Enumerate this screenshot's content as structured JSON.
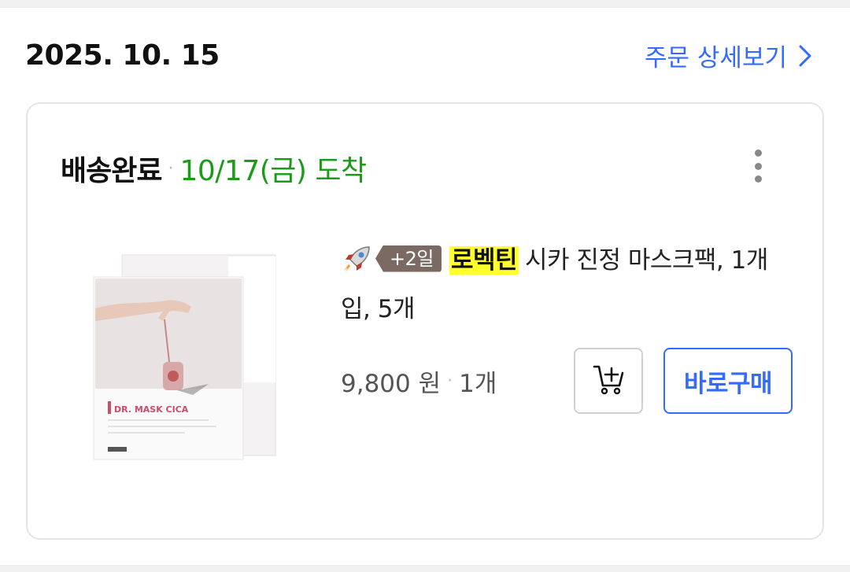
{
  "order": {
    "date": "2025. 10. 15",
    "detail_link_label": "주문 상세보기",
    "detail_link_icon": "chevron-right-icon"
  },
  "shipment": {
    "status": "배송완료",
    "separator": "·",
    "arrival": "10/17(금) 도착",
    "more_icon": "more-vertical-icon"
  },
  "product": {
    "image_label": "DR. MASK CICA",
    "rocket_icon": "rocket-icon",
    "delivery_badge": "+2일",
    "brand": "로벡틴",
    "name": "시카 진정 마스크팩, 1개입, 5개",
    "price": "9,800 원",
    "price_separator": "·",
    "quantity": "1개"
  },
  "actions": {
    "cart_icon": "add-to-cart-icon",
    "buy_now_label": "바로구매"
  },
  "colors": {
    "accent": "#346aff",
    "arrival_green": "#1a9b1a",
    "brand_highlight": "#ffff2b",
    "badge_bg": "#7b6a64"
  }
}
